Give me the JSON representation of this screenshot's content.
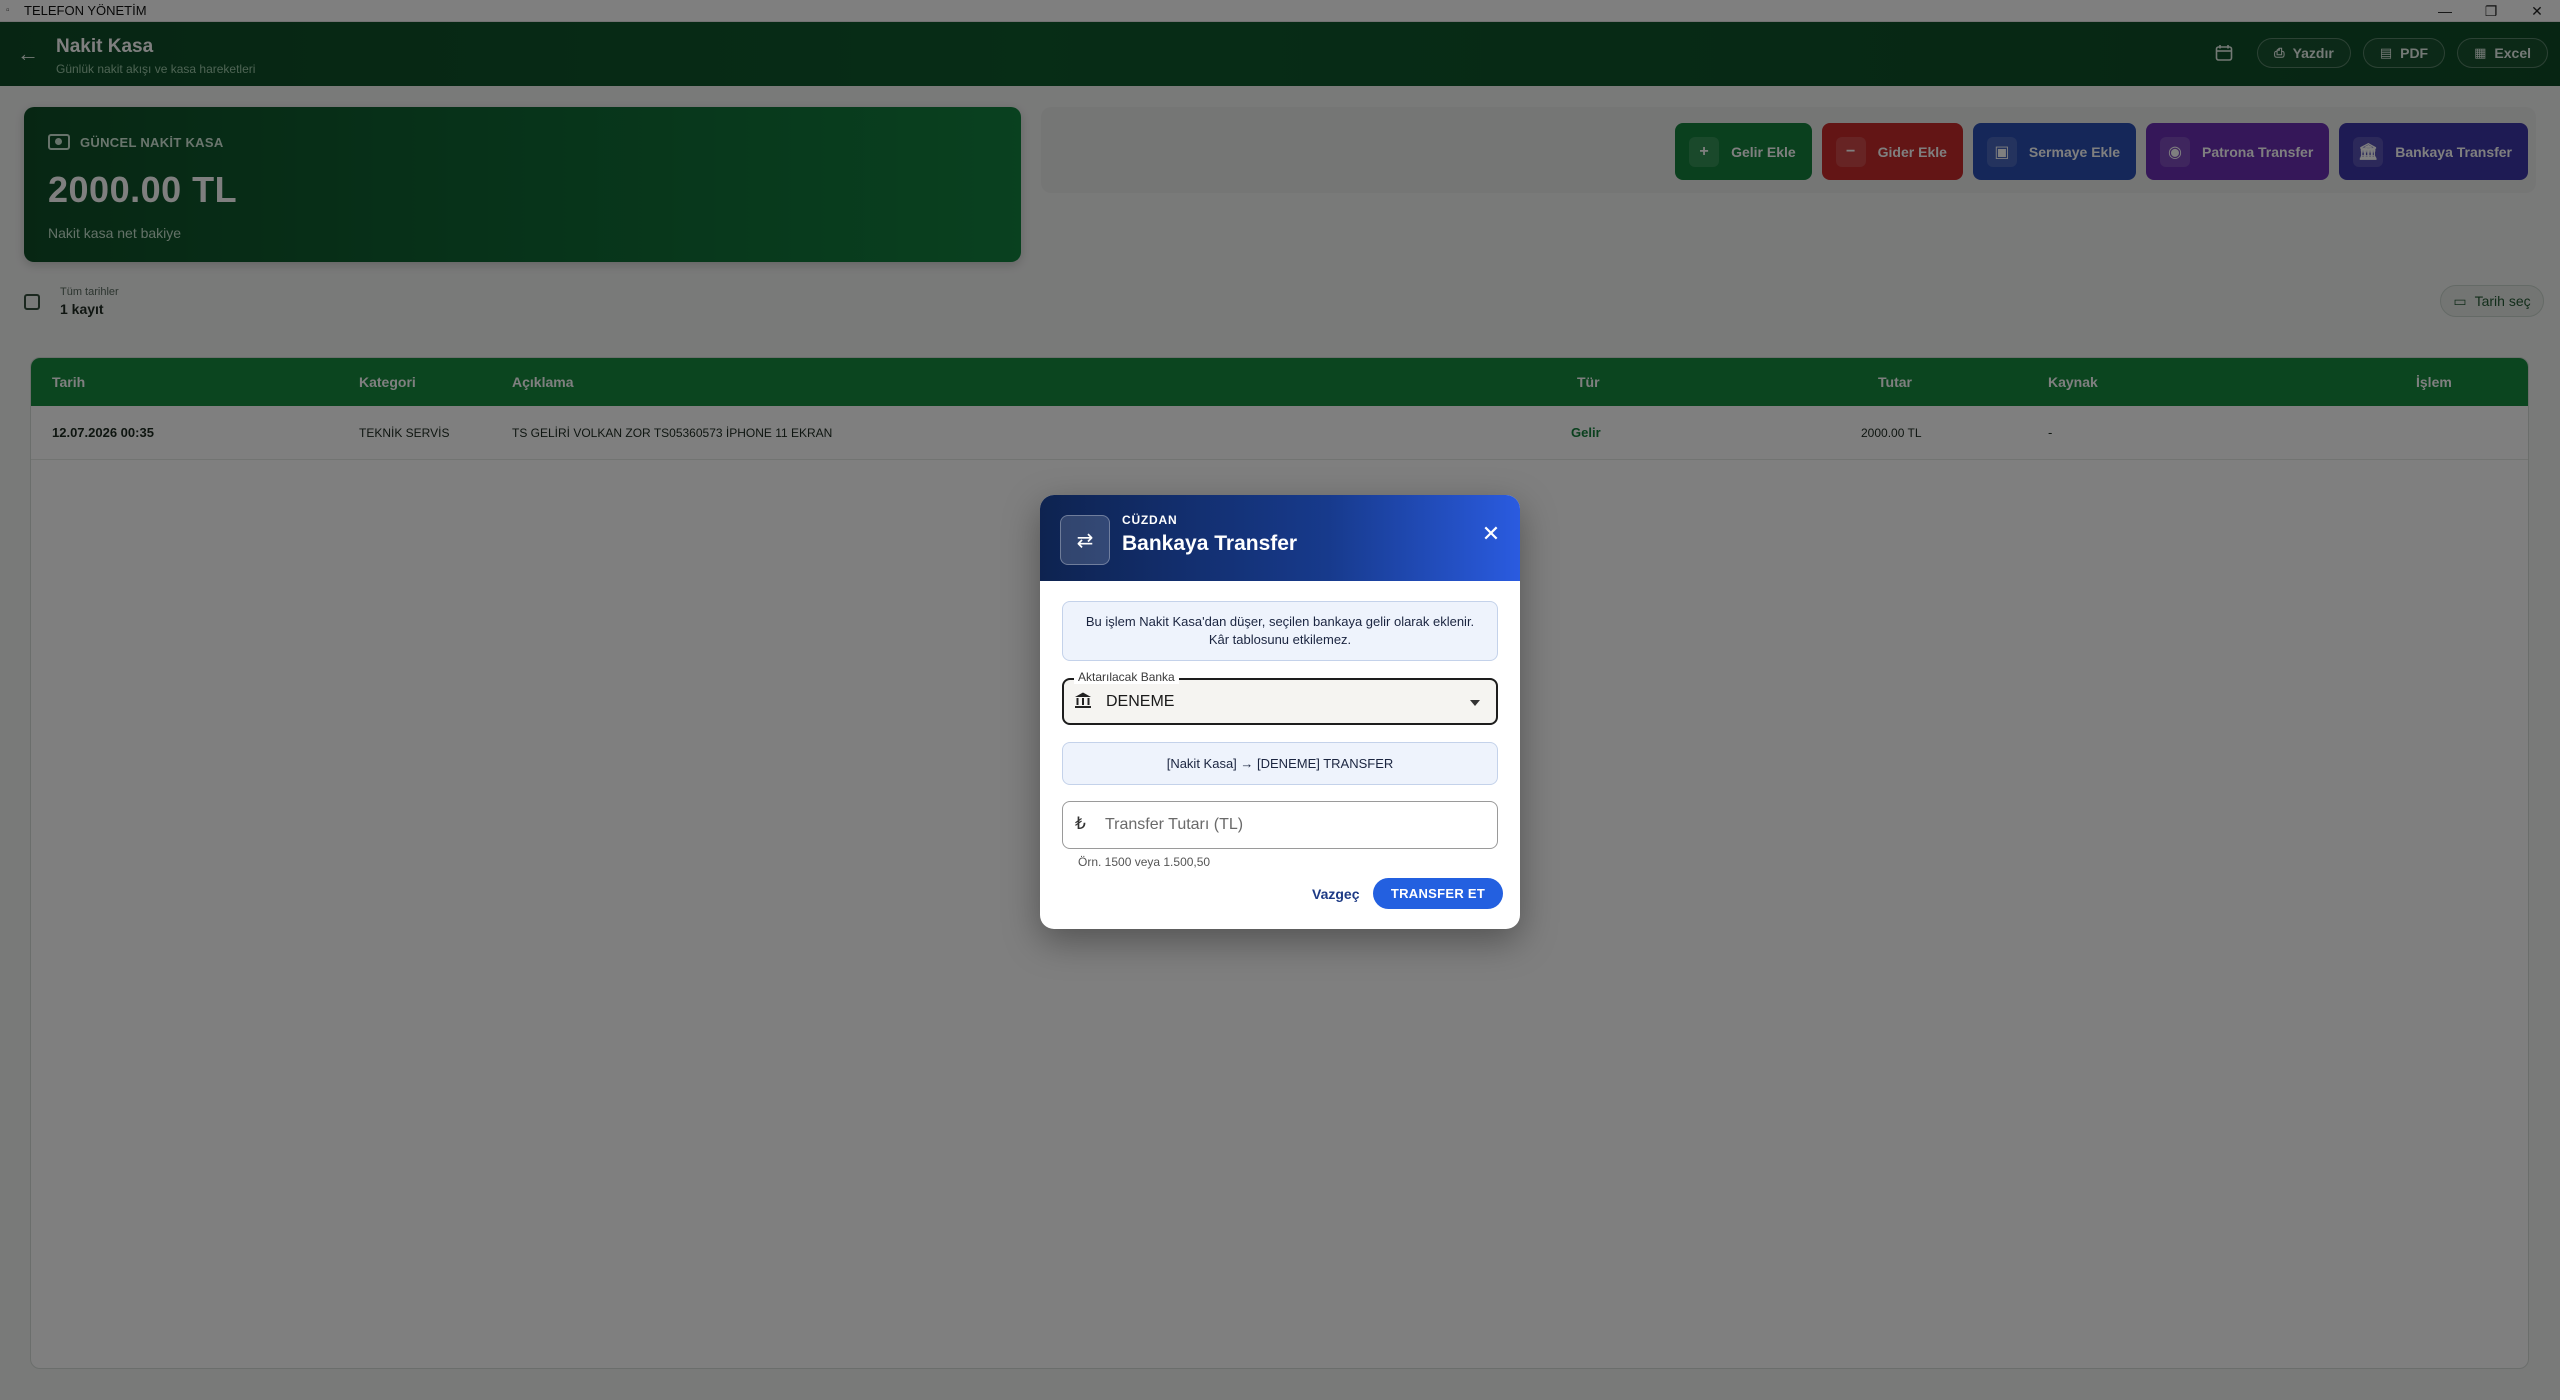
{
  "window": {
    "title": "TELEFON YÖNETİM"
  },
  "header": {
    "title": "Nakit Kasa",
    "subtitle": "Günlük nakit akışı ve kasa hareketleri",
    "print_label": "Yazdır",
    "pdf_label": "PDF",
    "excel_label": "Excel"
  },
  "balance": {
    "label": "GÜNCEL NAKİT KASA",
    "value": "2000.00 TL",
    "subtitle": "Nakit kasa net bakiye"
  },
  "actions": {
    "income": "Gelir Ekle",
    "expense": "Gider Ekle",
    "capital": "Sermaye Ekle",
    "boss": "Patrona Transfer",
    "bank": "Bankaya Transfer"
  },
  "filter": {
    "label": "Tüm tarihler",
    "count": "1 kayıt",
    "date_button": "Tarih seç"
  },
  "table": {
    "columns": [
      "Tarih",
      "Kategori",
      "Açıklama",
      "Tür",
      "Tutar",
      "Kaynak",
      "İşlem"
    ],
    "rows": [
      {
        "date": "12.07.2026 00:35",
        "category": "TEKNİK SERVİS",
        "description": "TS GELİRİ VOLKAN ZOR TS05360573 İPHONE 11 EKRAN",
        "type": "Gelir",
        "amount": "2000.00 TL",
        "source": "-"
      }
    ]
  },
  "dialog": {
    "kicker": "CÜZDAN",
    "title": "Bankaya Transfer",
    "info_line1": "Bu işlem Nakit Kasa'dan düşer, seçilen bankaya gelir olarak eklenir.",
    "info_line2": "Kâr tablosunu etkilemez.",
    "bank_label": "Aktarılacak Banka",
    "bank_value": "DENEME",
    "preview": "[Nakit Kasa] → [DENEME] TRANSFER",
    "amount_placeholder": "Transfer Tutarı (TL)",
    "amount_hint": "Örn. 1500 veya 1.500,50",
    "cancel": "Vazgeç",
    "submit": "TRANSFER ET"
  },
  "colors": {
    "header_green": "#0f5a2d",
    "table_header_green": "#168a3f",
    "income_green": "#14803c",
    "expense_red": "#c62a2a",
    "capital_blue": "#2a4fb3",
    "boss_purple": "#6a2fb3",
    "bank_indigo": "#3d36a8",
    "dialog_blue": "#2360e0"
  },
  "icons": {
    "back": "arrow-left-icon",
    "calendar": "calendar-icon",
    "print": "printer-icon",
    "pdf": "document-icon",
    "excel": "table-icon",
    "cash": "cash-icon",
    "swap": "swap-arrows-icon",
    "close": "close-icon",
    "bank": "bank-icon",
    "lira": "lira-icon"
  }
}
